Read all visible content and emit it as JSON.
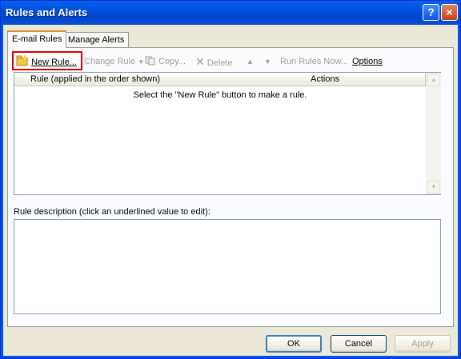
{
  "window": {
    "title": "Rules and Alerts",
    "help": "?",
    "close": "×"
  },
  "tabs": [
    {
      "label": "E-mail Rules"
    },
    {
      "label": "Manage Alerts"
    }
  ],
  "toolbar": {
    "new_rule": "New Rule...",
    "change_rule": "Change Rule",
    "copy": "Copy...",
    "delete": "Delete",
    "run_rules_now": "Run Rules Now...",
    "options": "Options"
  },
  "rules_list": {
    "columns": [
      "Rule (applied in the order shown)",
      "Actions"
    ],
    "empty_message": "Select the \"New Rule\" button to make a rule."
  },
  "description": {
    "label": "Rule description (click an underlined value to edit):",
    "value": ""
  },
  "buttons": {
    "ok": "OK",
    "cancel": "Cancel",
    "apply": "Apply"
  },
  "colors": {
    "titlebar": "#0054e3",
    "highlight_box": "#e00000",
    "active_tab_accent": "#e68b2c"
  }
}
